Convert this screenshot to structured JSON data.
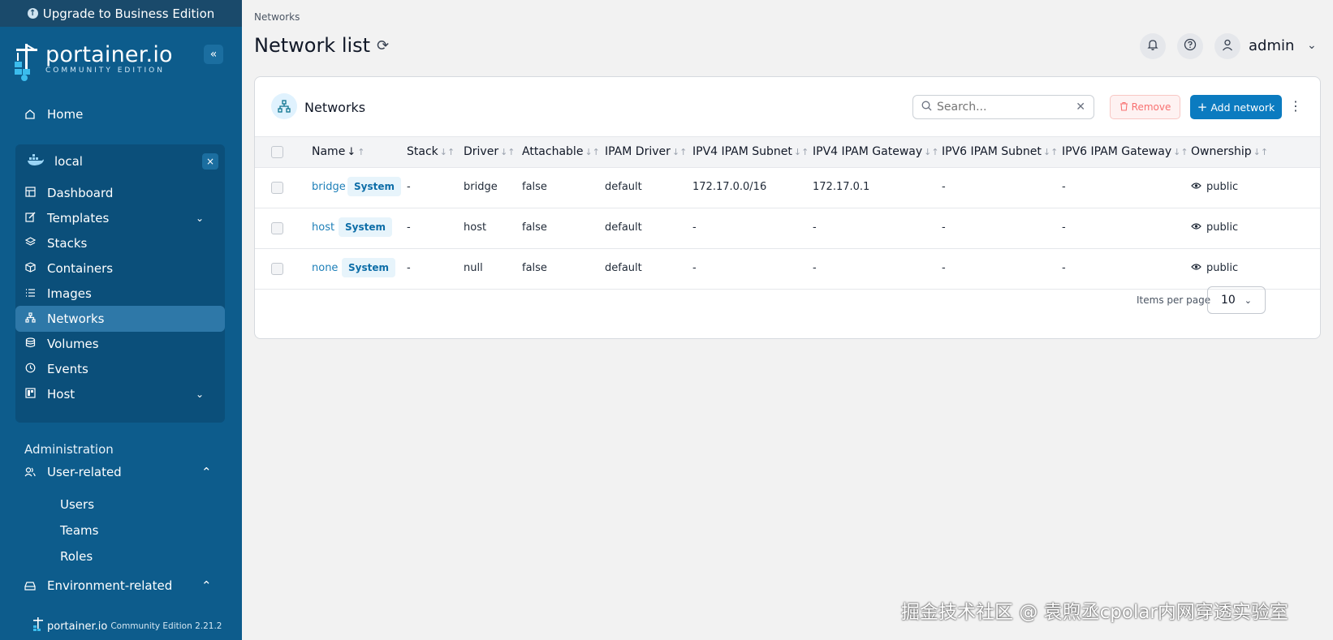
{
  "sidebar": {
    "upgrade_label": "Upgrade to Business Edition",
    "brand_name": "portainer.io",
    "brand_sub": "COMMUNITY EDITION",
    "home_label": "Home",
    "environment": {
      "name": "local",
      "items": [
        {
          "label": "Dashboard",
          "icon": "dashboard-icon"
        },
        {
          "label": "Templates",
          "icon": "edit-icon"
        },
        {
          "label": "Stacks",
          "icon": "layers-icon"
        },
        {
          "label": "Containers",
          "icon": "box-icon"
        },
        {
          "label": "Images",
          "icon": "list-icon"
        },
        {
          "label": "Networks",
          "icon": "network-icon"
        },
        {
          "label": "Volumes",
          "icon": "database-icon"
        },
        {
          "label": "Events",
          "icon": "clock-icon"
        },
        {
          "label": "Host",
          "icon": "host-icon"
        }
      ]
    },
    "administration_label": "Administration",
    "user_related_label": "User-related",
    "user_related_items": [
      "Users",
      "Teams",
      "Roles"
    ],
    "environment_related_label": "Environment-related",
    "footer_brand": "portainer.io",
    "footer_edition": "Community Edition 2.21.2"
  },
  "header": {
    "breadcrumb": "Networks",
    "title": "Network list",
    "user": "admin"
  },
  "card": {
    "title": "Networks",
    "search_placeholder": "Search...",
    "remove_label": "Remove",
    "add_label": "Add network",
    "columns": [
      "Name",
      "Stack",
      "Driver",
      "Attachable",
      "IPAM Driver",
      "IPV4 IPAM Subnet",
      "IPV4 IPAM Gateway",
      "IPV6 IPAM Subnet",
      "IPV6 IPAM Gateway",
      "Ownership"
    ],
    "rows": [
      {
        "name": "bridge",
        "badge": "System",
        "stack": "-",
        "driver": "bridge",
        "attachable": "false",
        "ipam_driver": "default",
        "ipv4_subnet": "172.17.0.0/16",
        "ipv4_gateway": "172.17.0.1",
        "ipv6_subnet": "-",
        "ipv6_gateway": "-",
        "ownership": "public"
      },
      {
        "name": "host",
        "badge": "System",
        "stack": "-",
        "driver": "host",
        "attachable": "false",
        "ipam_driver": "default",
        "ipv4_subnet": "-",
        "ipv4_gateway": "-",
        "ipv6_subnet": "-",
        "ipv6_gateway": "-",
        "ownership": "public"
      },
      {
        "name": "none",
        "badge": "System",
        "stack": "-",
        "driver": "null",
        "attachable": "false",
        "ipam_driver": "default",
        "ipv4_subnet": "-",
        "ipv4_gateway": "-",
        "ipv6_subnet": "-",
        "ipv6_gateway": "-",
        "ownership": "public"
      }
    ],
    "items_per_page_label": "Items per page",
    "items_per_page_value": "10"
  },
  "watermark": "掘金技术社区 @ 袁煦丞cpolar内网穿透实验室",
  "colors": {
    "sidebar": "#0d5c8c",
    "accent": "#0b7bc0",
    "link": "#1d7fb8"
  }
}
